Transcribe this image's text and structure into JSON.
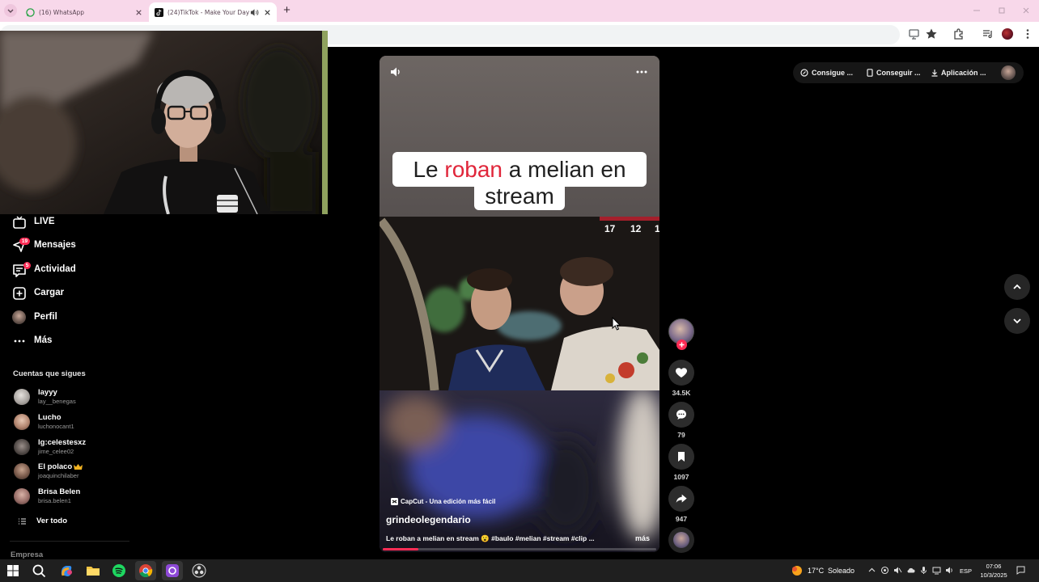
{
  "browser": {
    "tabs": [
      {
        "title": "(16) WhatsApp",
        "icon": "whatsapp-icon"
      },
      {
        "title": "(24)TikTok - Make Your Day",
        "icon": "tiktok-icon"
      }
    ],
    "new_tab": "+",
    "toolbar_icons": [
      "install-icon",
      "star-icon",
      "extensions-icon",
      "media-icon",
      "profile-avatar",
      "menu-icon"
    ]
  },
  "header_links": [
    {
      "label": "Consigue ...",
      "icon": "coins-icon"
    },
    {
      "label": "Conseguir ...",
      "icon": "phone-icon"
    },
    {
      "label": "Aplicación ...",
      "icon": "download-icon"
    }
  ],
  "sidebar": {
    "nav": [
      {
        "label": "LIVE",
        "icon": "live-icon"
      },
      {
        "label": "Mensajes",
        "icon": "messages-icon",
        "badge": "19"
      },
      {
        "label": "Actividad",
        "icon": "activity-icon",
        "badge": "5"
      },
      {
        "label": "Cargar",
        "icon": "upload-icon"
      },
      {
        "label": "Perfil",
        "icon": "profile-avatar"
      },
      {
        "label": "Más",
        "icon": "more-icon"
      }
    ],
    "following_title": "Cuentas que sigues",
    "following": [
      {
        "name": "layyy",
        "handle": "lay__benegas"
      },
      {
        "name": "Lucho",
        "handle": "luchonocant1"
      },
      {
        "name": "lg:celestesxz",
        "handle": "jime_celee02"
      },
      {
        "name": "El polaco",
        "handle": "joaquinchilaber",
        "badge_icon": "crown-icon"
      },
      {
        "name": "Brisa Belen",
        "handle": "brisa.belen1"
      }
    ],
    "see_all": "Ver todo",
    "footer": "Empresa"
  },
  "video": {
    "caption": {
      "line1": [
        "Le",
        "roban",
        "a melian en"
      ],
      "line2": "stream"
    },
    "scoreboard": [
      "17",
      "12",
      "1"
    ],
    "capcut": "CapCut - Una edición más fácil",
    "author": "grindeolegendario",
    "description": "Le roban a melian en stream 😮 #baulo #melian #stream #clip ...",
    "more": "más",
    "progress": 0.13
  },
  "actions": {
    "likes": "34.5K",
    "comments": "79",
    "saves": "1097",
    "shares": "947"
  },
  "taskbar": {
    "temperature": "17°C",
    "weather": "Soleado",
    "language": "ESP",
    "time": "07:06",
    "date": "10/3/2025"
  },
  "colors": {
    "accent": "#fe2c55",
    "tab_bar": "#f8d8ea",
    "page_background": "#000000",
    "taskbar": "#1f1f1f"
  }
}
